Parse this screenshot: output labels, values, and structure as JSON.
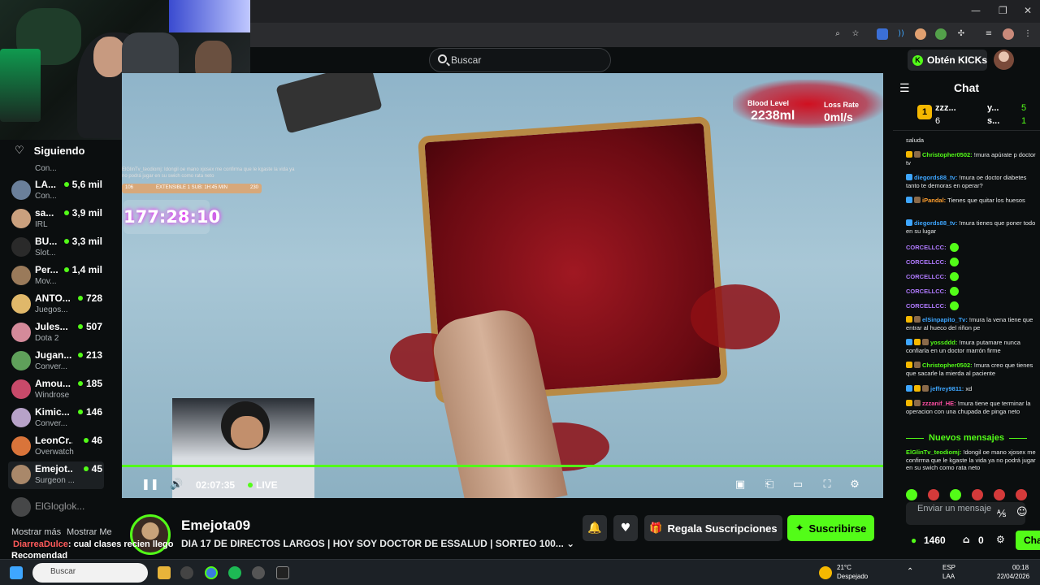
{
  "browser": {
    "minimize": "—",
    "maximize": "❐",
    "close": "✕"
  },
  "header": {
    "search_placeholder": "Buscar",
    "kicks_button": "Obtén KICKs"
  },
  "sidebar": {
    "heading": "Siguiendo",
    "channels": [
      {
        "name": "",
        "category": "Con...",
        "viewers": ""
      },
      {
        "name": "LA...",
        "category": "Con...",
        "viewers": "5,6 mil"
      },
      {
        "name": "sa...",
        "category": "IRL",
        "viewers": "3,9 mil"
      },
      {
        "name": "BU...",
        "category": "Slot...",
        "viewers": "3,3 mil"
      },
      {
        "name": "Per...",
        "category": "Mov...",
        "viewers": "1,4 mil"
      },
      {
        "name": "ANTO...",
        "category": "Juegos...",
        "viewers": "728"
      },
      {
        "name": "Jules...",
        "category": "Dota 2",
        "viewers": "507"
      },
      {
        "name": "Jugan...",
        "category": "Conver...",
        "viewers": "213"
      },
      {
        "name": "Amou...",
        "category": "Windrose",
        "viewers": "185"
      },
      {
        "name": "Kimic...",
        "category": "Conver...",
        "viewers": "146"
      },
      {
        "name": "LeonCr...",
        "category": "Overwatch",
        "viewers": "46"
      },
      {
        "name": "Emejot...",
        "category": "Surgeon ...",
        "viewers": "45"
      },
      {
        "name": "ElGloglok...",
        "category": "",
        "viewers": ""
      }
    ],
    "show_more": "Mostrar más",
    "show_less": "Mostrar Me",
    "recommended": "Recomendad"
  },
  "overlay": {
    "msg_user": "DiarreaDulce",
    "msg_text": ": cual clases recien llego"
  },
  "video": {
    "blood_level_label": "Blood Level",
    "blood_level_value": "2238ml",
    "loss_rate_label": "Loss Rate",
    "loss_rate_value": "0ml/s",
    "overlay_message": "ElGlinTv_teodiomj: Idongil oe mano xjosex me confirma que le kgaste la vida ya no podrá jugar en su swich como rata neto",
    "sub_bar_left": "106",
    "sub_bar_mid": "EXTENSIBLE 1 SUB: 1H:45 MIN",
    "sub_bar_right": "230",
    "timer": "177:28:10",
    "elapsed": "02:07:35",
    "live_label": "LIVE",
    "progress": 1.0
  },
  "stream": {
    "streamer_name": "Emejota09",
    "title": "DIA 17 DE DIRECTOS LARGOS | HOY SOY DOCTOR DE ESSALUD | SORTEO 100...",
    "gift_label": "Regala Suscripciones",
    "subscribe_label": "Suscribirse"
  },
  "chat": {
    "title": "Chat",
    "leaderboard": [
      {
        "rank": "1",
        "name": "zzz...",
        "count": "6"
      },
      {
        "name": "y...",
        "count": "5"
      },
      {
        "name": "s...",
        "count": "1"
      }
    ],
    "messages": [
      {
        "user": "",
        "text": "saluda",
        "color": "#e6e8e9"
      },
      {
        "user": "Christopher0502:",
        "text": " !mura apúrate p doctor tv",
        "color": "#53fc18"
      },
      {
        "user": "diegords88_tv:",
        "text": " !mura oe doctor diabetes tanto te demoras en operar?",
        "color": "#3ea6ff"
      },
      {
        "user": "iPandal:",
        "text": " Tienes que quitar los huesos",
        "color": "#ff9f2e"
      },
      {
        "user": "diegords88_tv:",
        "text": " !mura tienes que poner todo en su lugar",
        "color": "#3ea6ff"
      },
      {
        "user": "CORCELLCC:",
        "text": "",
        "color": "#b17bff"
      },
      {
        "user": "CORCELLCC:",
        "text": "",
        "color": "#b17bff"
      },
      {
        "user": "CORCELLCC:",
        "text": "",
        "color": "#b17bff"
      },
      {
        "user": "CORCELLCC:",
        "text": "",
        "color": "#b17bff"
      },
      {
        "user": "CORCELLCC:",
        "text": "",
        "color": "#b17bff"
      },
      {
        "user": "elSinpapito_Tv:",
        "text": " !mura la vena tiene que entrar al hueco del riñon pe",
        "color": "#3ea6ff"
      },
      {
        "user": "yossddd:",
        "text": " !mura putamare nunca confiarla en un doctor marrón firme",
        "color": "#53fc18"
      },
      {
        "user": "Christopher0502:",
        "text": " !mura creo que tienes que sacarle la mierda al paciente",
        "color": "#53fc18"
      },
      {
        "user": "jeffrey9811:",
        "text": " xd",
        "color": "#3ea6ff"
      },
      {
        "user": "zzzanif_HE:",
        "text": " !mura tiene que terminar la operacion con una chupada de pinga neto",
        "color": "#ff4fa3"
      }
    ],
    "new_messages": "Nuevos mensajes",
    "pinned_user": "ElGlinTv_teodiomj:",
    "pinned_text": " !dongil oe mano xjosex me confirma que le kgaste la vida ya no podrá jugar en su swich como rata neto",
    "input_placeholder": "Enviar un mensaje",
    "points": "1460",
    "drops": "0",
    "chat_button": "Cha"
  },
  "taskbar": {
    "search": "Buscar",
    "weather_temp": "21°C",
    "weather_desc": "Despejado",
    "lang_top": "ESP",
    "lang_bottom": "LAA",
    "time": "00:18",
    "date": "22/04/2026"
  },
  "colors": {
    "accent": "#53fc18",
    "background": "#0b0e0f"
  }
}
